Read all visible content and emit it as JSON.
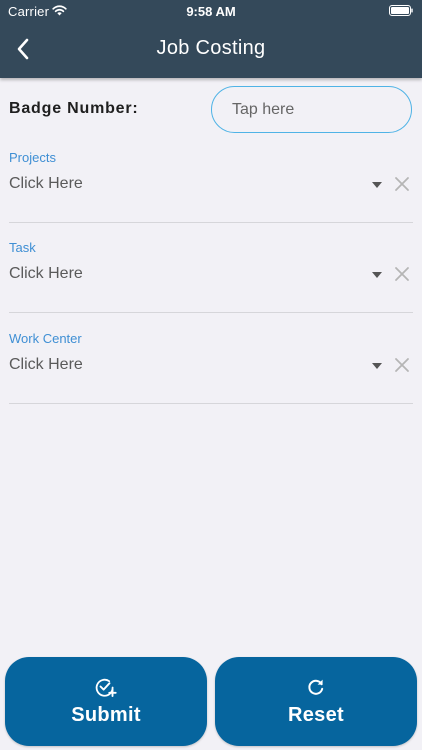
{
  "status_bar": {
    "carrier": "Carrier",
    "time": "9:58 AM",
    "icons": [
      "wifi-icon",
      "battery-icon"
    ]
  },
  "nav": {
    "title": "Job Costing",
    "back_icon": "chevron-left-icon"
  },
  "badge": {
    "label": "Badge Number:",
    "placeholder": "Tap here",
    "value": ""
  },
  "fields": [
    {
      "label": "Projects",
      "value": "Click Here"
    },
    {
      "label": "Task",
      "value": "Click Here"
    },
    {
      "label": "Work Center",
      "value": "Click Here"
    }
  ],
  "actions": {
    "submit": {
      "label": "Submit",
      "icon": "check-circle-plus-icon"
    },
    "reset": {
      "label": "Reset",
      "icon": "refresh-icon"
    }
  },
  "colors": {
    "header_bg": "#34495a",
    "page_bg": "#f2f1f6",
    "field_label": "#3f8fd4",
    "input_border": "#4fb3e6",
    "button_bg": "#06659e"
  }
}
